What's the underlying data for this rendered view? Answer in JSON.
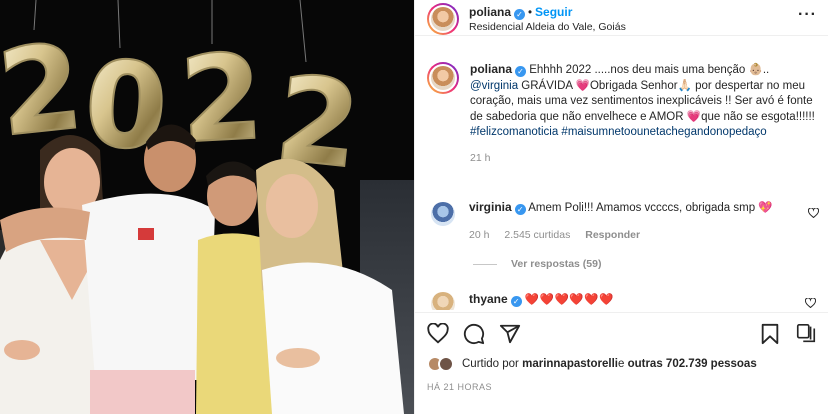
{
  "post": {
    "username": "poliana",
    "follow_label": "Seguir",
    "location": "Residencial Aldeia do Vale, Goiás",
    "balloons": "2022",
    "caption": {
      "username": "poliana",
      "part1": "Ehhhh 2022 .....nos deu mais uma benção 👶🏼..",
      "mention": "@virginia",
      "part2": " GRÁVIDA ",
      "part3": "Obrigada Senhor🙏🏻 por despertar no meu coração, mais uma vez sentimentos inexplicáveis !! Ser avó é fonte de sabedoria que não envelhece e AMOR ",
      "part4": "que não se esgota!!!!!! ",
      "tag1": "#felizcomanoticia",
      "tag2": "#maisumnetoounetachegandonopedaço",
      "age": "21 h"
    },
    "comment": {
      "username": "virginia",
      "text": "Amem Poli!!! Amamos vccccs, obrigada smp ",
      "age": "20 h",
      "likes": "2.545 curtidas",
      "reply": "Responder"
    },
    "view_replies": "Ver respostas (59)",
    "comment2": {
      "username": "thyane",
      "text": "❤️❤️❤️❤️❤️❤️"
    },
    "likes": {
      "prefix": "Curtido por ",
      "user": "marinnapastorelli",
      "middle": " e ",
      "others": "outras 702.739 pessoas"
    },
    "time_ago": "HÁ 21 HORAS"
  },
  "colors": {
    "accent": "#0095f6",
    "verified": "#3897f0",
    "heart": "#e84a8a",
    "muted": "#8e8e8e"
  },
  "icons": [
    "verified-icon",
    "more-options-icon",
    "heart-icon",
    "comment-icon",
    "share-icon",
    "bookmark-icon",
    "carousel-icon"
  ]
}
